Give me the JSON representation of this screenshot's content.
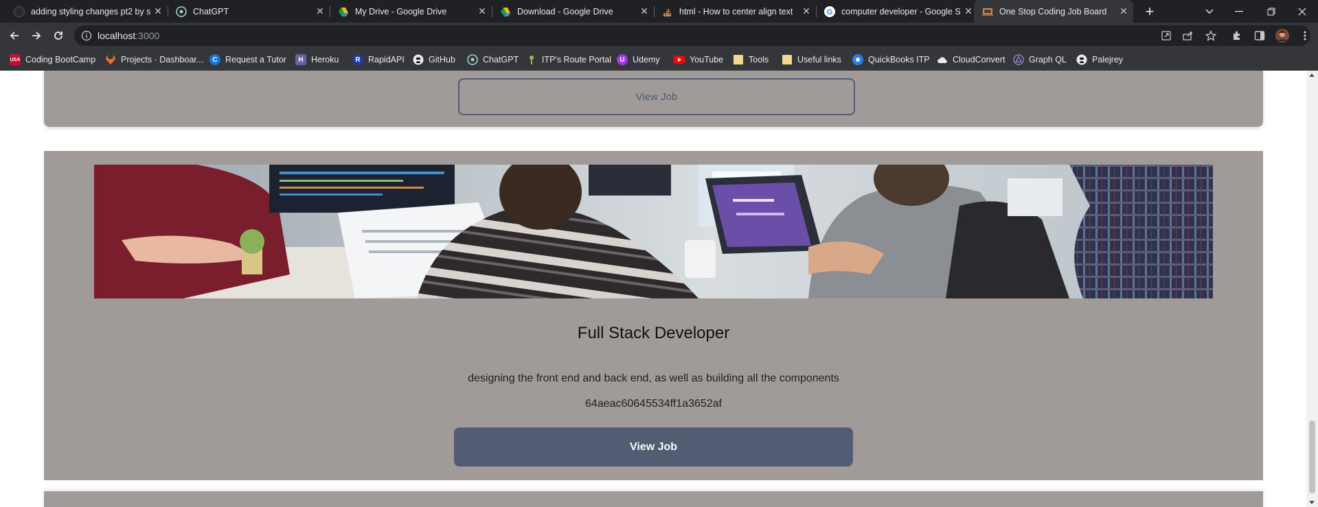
{
  "browser": {
    "tabs": [
      {
        "title": "adding styling changes pt2 by s",
        "icon": "github-icon"
      },
      {
        "title": "ChatGPT",
        "icon": "chatgpt-icon"
      },
      {
        "title": "My Drive - Google Drive",
        "icon": "google-drive-icon"
      },
      {
        "title": "Download - Google Drive",
        "icon": "google-drive-icon"
      },
      {
        "title": "html - How to center align text",
        "icon": "stackoverflow-icon"
      },
      {
        "title": "computer developer - Google S",
        "icon": "google-icon"
      },
      {
        "title": "One Stop Coding Job Board",
        "icon": "site-icon",
        "active": true
      }
    ],
    "address": {
      "host": "localhost",
      "port": ":3000"
    },
    "bookmarks": [
      {
        "label": "Coding BootCamp",
        "icon": "usa-icon"
      },
      {
        "label": "Projects · Dashboar...",
        "icon": "gitlab-icon"
      },
      {
        "label": "Request a Tutor",
        "icon": "tutor-icon"
      },
      {
        "label": "Heroku",
        "icon": "heroku-icon"
      },
      {
        "label": "RapidAPI",
        "icon": "rapidapi-icon"
      },
      {
        "label": "GitHub",
        "icon": "github-icon"
      },
      {
        "label": "ChatGPT",
        "icon": "chatgpt-icon"
      },
      {
        "label": "ITP's Route Portal",
        "icon": "route-icon"
      },
      {
        "label": "Udemy",
        "icon": "udemy-icon"
      },
      {
        "label": "YouTube",
        "icon": "youtube-icon"
      },
      {
        "label": "Tools",
        "icon": "folder-icon"
      },
      {
        "label": "Useful links",
        "icon": "folder-icon"
      },
      {
        "label": "QuickBooks ITP",
        "icon": "quickbooks-icon"
      },
      {
        "label": "CloudConvert",
        "icon": "cloudconvert-icon"
      },
      {
        "label": "Graph QL",
        "icon": "graphql-icon"
      },
      {
        "label": "Palejrey",
        "icon": "github-icon"
      }
    ]
  },
  "page": {
    "prev_card": {
      "button_label": "View Job"
    },
    "card": {
      "title": "Full Stack Developer",
      "description": "designing the front end and back end, as well as building all the components",
      "id": "64aeac60645534ff1a3652af",
      "button_label": "View Job"
    }
  },
  "colors": {
    "card_background": "#a09a98",
    "button_primary": "#525c73",
    "chrome_dark": "#202124",
    "chrome_toolbar": "#35363a"
  }
}
